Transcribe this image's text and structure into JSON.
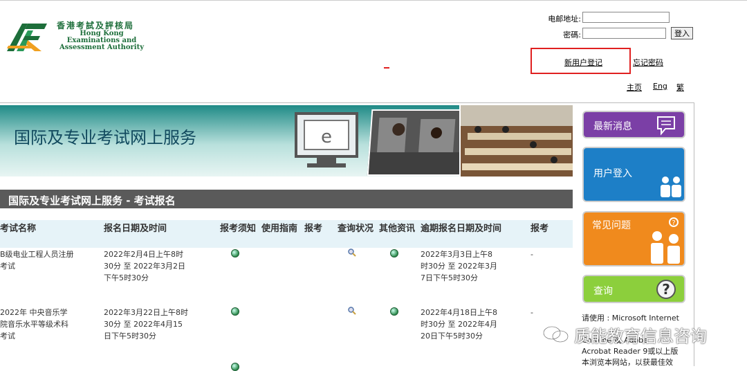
{
  "logo": {
    "name_cn": "香港考試及評核局",
    "name_en_1": "Hong Kong",
    "name_en_2": "Examinations and",
    "name_en_3": "Assessment Authority"
  },
  "login": {
    "email_label": "电邮地址:",
    "password_label": "密碼:",
    "email_value": "",
    "password_value": "",
    "submit_label": "登入"
  },
  "links": {
    "register": "新用户登记",
    "forgot_password": "忘记密码",
    "home": "主页",
    "english": "Eng",
    "traditional": "繁"
  },
  "banner": {
    "title": "国际及专业考试网上服务"
  },
  "section": {
    "title": "国际及专业考试网上服务 - 考试报名"
  },
  "table": {
    "headers": [
      "考试名称",
      "报名日期及时间",
      "报考须知",
      "使用指南",
      "报考",
      "查询状况",
      "其他资讯",
      "逾期报名日期及时间",
      "报考"
    ],
    "rows": [
      {
        "name": "B级电业工程人员注册考试",
        "period": "2022年2月4日上午8时30分 至 2022年3月2日下午5时30分",
        "late": "2022年3月3日上午8时30分 至 2022年3月7日下午5时30分",
        "apply": "-"
      },
      {
        "name": "2022年 中央音乐学院音乐水平等级术科考试",
        "period": "2022年3月22日上午8时30分 至 2022年4月15日下午5时30分",
        "late": "2022年4月18日上午8时30分 至 2022年4月20日下午5时30分",
        "apply": "-"
      }
    ]
  },
  "sidebar": {
    "news": "最新消息",
    "login": "用户登入",
    "faq": "常见问题",
    "enquiry": "查询",
    "colors": {
      "news": "#7b3fa6",
      "login": "#1d7fc7",
      "faq": "#f08a1d",
      "enquiry": "#8ccf3c"
    }
  },
  "info": {
    "line1": "请使用 : Microsoft Internet",
    "line2": "Chrome 或 Adobe",
    "line3": "Acrobat Reader 9或以上版",
    "line4": "本浏览本网站，以获最佳效"
  },
  "watermark": "质能教育信息咨询"
}
